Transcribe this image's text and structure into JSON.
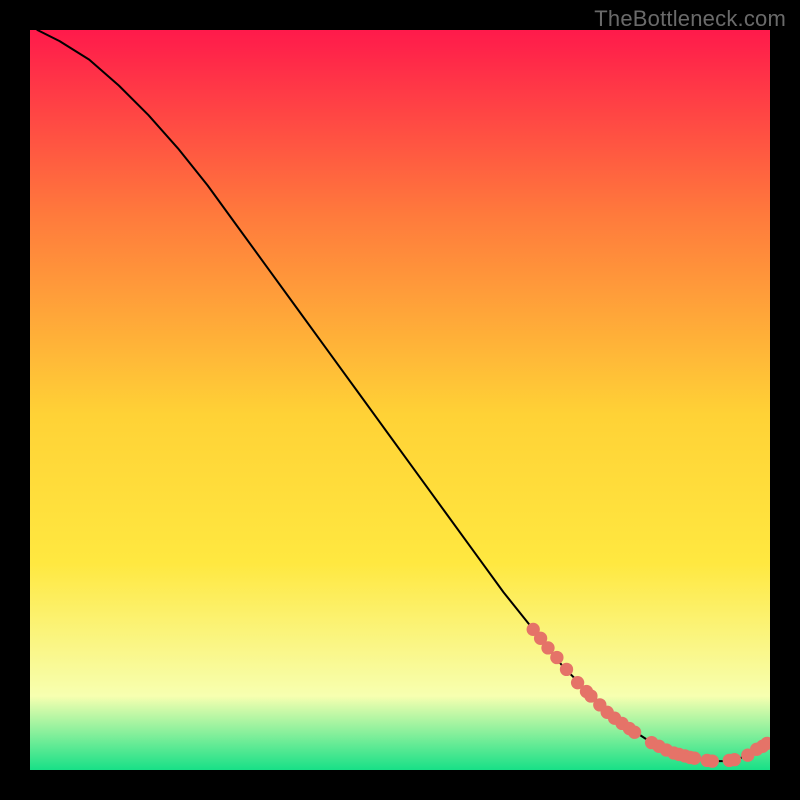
{
  "watermark": "TheBottleneck.com",
  "chart_data": {
    "type": "line",
    "title": "",
    "xlabel": "",
    "ylabel": "",
    "xlim": [
      0,
      100
    ],
    "ylim": [
      0,
      100
    ],
    "grid": false,
    "legend": false,
    "background_gradient": {
      "top_color": "#ff1a4b",
      "mid_upper_color": "#ff7a3c",
      "mid_color": "#ffd236",
      "mid_lower_color": "#ffe840",
      "near_bottom_color": "#f7ffb0",
      "bottom_color": "#17e087"
    },
    "series": [
      {
        "name": "bottleneck-curve",
        "color": "#000000",
        "x": [
          1,
          4,
          8,
          12,
          16,
          20,
          24,
          28,
          32,
          36,
          40,
          44,
          48,
          52,
          56,
          60,
          64,
          68,
          72,
          76,
          80,
          82,
          84,
          86,
          88,
          90,
          92,
          94,
          96,
          98,
          99.5
        ],
        "y": [
          100,
          98.5,
          96,
          92.5,
          88.5,
          84.0,
          79.0,
          73.5,
          68.0,
          62.5,
          57.0,
          51.5,
          46.0,
          40.5,
          35.0,
          29.5,
          24.0,
          19.0,
          14.0,
          10.0,
          6.5,
          5.0,
          3.7,
          2.7,
          2.0,
          1.5,
          1.2,
          1.2,
          1.6,
          2.6,
          3.5
        ]
      }
    ],
    "markers": {
      "name": "highlight-points",
      "shape": "circle",
      "color": "#e57368",
      "radius_world": 0.9,
      "points": [
        {
          "x": 68.0,
          "y": 19.0
        },
        {
          "x": 69.0,
          "y": 17.8
        },
        {
          "x": 70.0,
          "y": 16.5
        },
        {
          "x": 71.2,
          "y": 15.2
        },
        {
          "x": 72.5,
          "y": 13.6
        },
        {
          "x": 74.0,
          "y": 11.8
        },
        {
          "x": 75.2,
          "y": 10.6
        },
        {
          "x": 75.8,
          "y": 10.0
        },
        {
          "x": 77.0,
          "y": 8.8
        },
        {
          "x": 78.0,
          "y": 7.8
        },
        {
          "x": 79.0,
          "y": 7.0
        },
        {
          "x": 80.0,
          "y": 6.3
        },
        {
          "x": 81.0,
          "y": 5.6
        },
        {
          "x": 81.7,
          "y": 5.1
        },
        {
          "x": 84.0,
          "y": 3.7
        },
        {
          "x": 85.0,
          "y": 3.2
        },
        {
          "x": 86.0,
          "y": 2.7
        },
        {
          "x": 87.0,
          "y": 2.3
        },
        {
          "x": 87.7,
          "y": 2.1
        },
        {
          "x": 88.5,
          "y": 1.9
        },
        {
          "x": 89.2,
          "y": 1.7
        },
        {
          "x": 89.8,
          "y": 1.6
        },
        {
          "x": 91.5,
          "y": 1.3
        },
        {
          "x": 92.2,
          "y": 1.2
        },
        {
          "x": 94.5,
          "y": 1.3
        },
        {
          "x": 95.2,
          "y": 1.4
        },
        {
          "x": 97.0,
          "y": 2.0
        },
        {
          "x": 98.2,
          "y": 2.8
        },
        {
          "x": 99.0,
          "y": 3.2
        },
        {
          "x": 99.6,
          "y": 3.6
        }
      ]
    }
  }
}
